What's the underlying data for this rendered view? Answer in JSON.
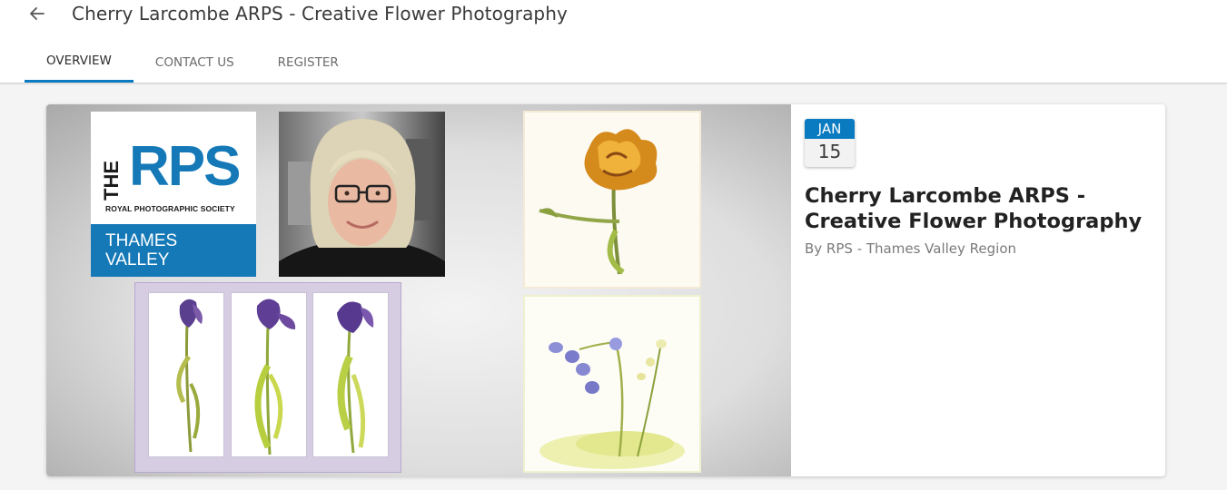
{
  "header": {
    "title": "Cherry Larcombe ARPS - Creative Flower Photography",
    "back_icon": "arrow-left-icon"
  },
  "tabs": [
    {
      "label": "OVERVIEW",
      "active": true
    },
    {
      "label": "CONTACT US",
      "active": false
    },
    {
      "label": "REGISTER",
      "active": false
    }
  ],
  "banner": {
    "logo": {
      "the": "THE",
      "letters": "RPS",
      "society": "ROYAL PHOTOGRAPHIC SOCIETY",
      "region_line1": "THAMES",
      "region_line2": "VALLEY"
    }
  },
  "event": {
    "month": "JAN",
    "day": "15",
    "title": "Cherry Larcombe ARPS - Creative Flower Photography",
    "organizer": "By RPS - Thames Valley Region"
  },
  "colors": {
    "accent": "#0b7bc1",
    "rps_blue": "#1579b7"
  }
}
